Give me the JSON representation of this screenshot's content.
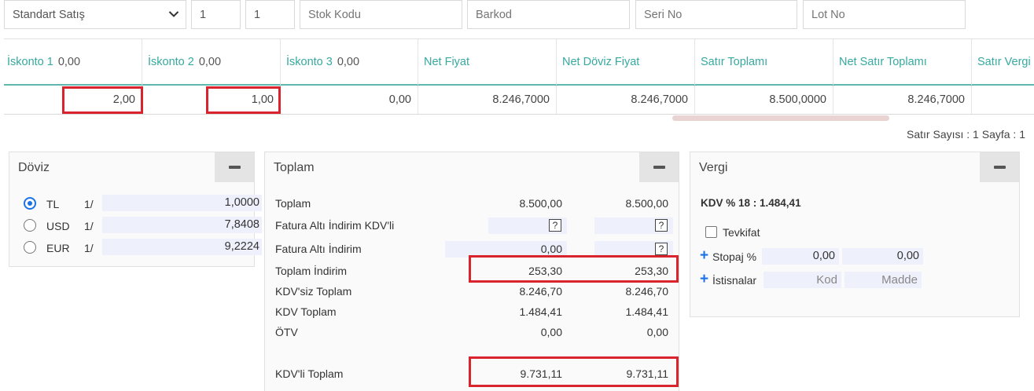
{
  "topbar": {
    "sale_type": "Standart Satış",
    "qty1": "1",
    "qty2": "1",
    "stock_code_placeholder": "Stok Kodu",
    "barcode_placeholder": "Barkod",
    "serial_placeholder": "Seri No",
    "lot_placeholder": "Lot No"
  },
  "grid": {
    "headers": [
      {
        "label": "İskonto 1",
        "value": "0,00"
      },
      {
        "label": "İskonto 2",
        "value": "0,00"
      },
      {
        "label": "İskonto 3",
        "value": "0,00"
      },
      {
        "label": "Net Fiyat",
        "value": ""
      },
      {
        "label": "Net Döviz Fiyat",
        "value": ""
      },
      {
        "label": "Satır Toplamı",
        "value": ""
      },
      {
        "label": "Net Satır Toplamı",
        "value": ""
      },
      {
        "label": "Satır Vergi",
        "value": ""
      }
    ],
    "row": [
      "2,00",
      "1,00",
      "0,00",
      "8.246,7000",
      "8.246,7000",
      "8.500,0000",
      "8.246,7000",
      ""
    ]
  },
  "status": "Satır Sayısı : 1 Sayfa : 1",
  "doviz": {
    "title": "Döviz",
    "rows": [
      {
        "code": "TL",
        "unit": "1/",
        "value": "1,0000",
        "selected": true
      },
      {
        "code": "USD",
        "unit": "1/",
        "value": "7,8408",
        "selected": false
      },
      {
        "code": "EUR",
        "unit": "1/",
        "value": "9,2224",
        "selected": false
      }
    ]
  },
  "toplam": {
    "title": "Toplam",
    "rows": [
      {
        "label": "Toplam",
        "v1": "8.500,00",
        "v2": "8.500,00"
      },
      {
        "label": "Fatura Altı İndirim KDV'li",
        "v1": "",
        "v2": ""
      },
      {
        "label": "Fatura Altı İndirim",
        "v1": "0,00",
        "v2": ""
      },
      {
        "label": "Toplam İndirim",
        "v1": "253,30",
        "v2": "253,30"
      },
      {
        "label": "KDV'siz Toplam",
        "v1": "8.246,70",
        "v2": "8.246,70"
      },
      {
        "label": "KDV Toplam",
        "v1": "1.484,41",
        "v2": "1.484,41"
      },
      {
        "label": "ÖTV",
        "v1": "0,00",
        "v2": "0,00"
      },
      {
        "label": "KDV'li Toplam",
        "v1": "9.731,11",
        "v2": "9.731,11"
      }
    ],
    "help_glyph": "?"
  },
  "vergi": {
    "title": "Vergi",
    "kdv_line": "KDV % 18 : 1.484,41",
    "tevkifat_label": "Tevkifat",
    "stopaj_label": "Stopaj %",
    "stopaj_v1": "0,00",
    "stopaj_v2": "0,00",
    "istisna_label": "İstisnalar",
    "kod_placeholder": "Kod",
    "madde_placeholder": "Madde"
  },
  "colors": {
    "accent_teal": "#36a9a0",
    "highlight_red": "#d9232d",
    "radio_blue": "#1a73e8"
  },
  "icons": [
    "chevron-down-icon",
    "minus-icon",
    "plus-icon",
    "help-icon"
  ]
}
